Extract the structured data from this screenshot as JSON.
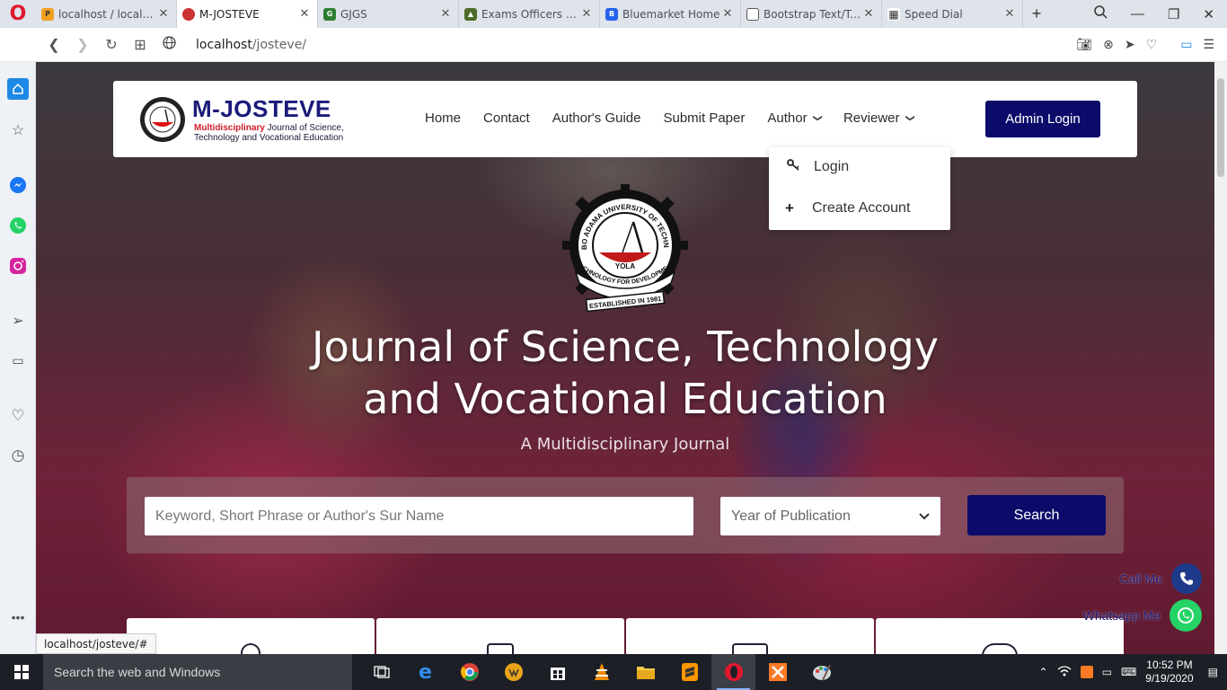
{
  "browser": {
    "tabs": [
      {
        "favicon": "phpmyadmin-favicon",
        "title": "localhost / localhost"
      },
      {
        "favicon": "mau-seal-favicon",
        "title": "M-JOSTEVE",
        "active": true
      },
      {
        "favicon": "leaf-favicon",
        "title": "GJGS"
      },
      {
        "favicon": "hat-favicon",
        "title": "Exams Officers Page"
      },
      {
        "favicon": "bluemarket-favicon",
        "title": "Bluemarket Home"
      },
      {
        "favicon": "document-favicon",
        "title": "Bootstrap Text/Typography"
      },
      {
        "favicon": "grid-favicon",
        "title": "Speed Dial"
      }
    ],
    "url": {
      "host": "localhost",
      "path": "/josteve/"
    },
    "status_url": "localhost/josteve/#"
  },
  "site": {
    "logo": {
      "title": "M-JOSTEVE",
      "sub_red": "Multidisciplinary",
      "sub_rest": " Journal of Science, Technology and Vocational Education"
    },
    "menu": {
      "home": "Home",
      "contact": "Contact",
      "guide": "Author's Guide",
      "submit": "Submit Paper",
      "author": "Author",
      "reviewer": "Reviewer"
    },
    "admin_login": "Admin Login",
    "author_dropdown": {
      "login": "Login",
      "create": "Create Account"
    },
    "seal": {
      "top_text": "MODIBBO ADAMA UNIVERSITY OF TECHNOLOGY",
      "center_text": "YOLA",
      "ribbon1": "TECHNOLOGY FOR DEVELOPMENT",
      "ribbon2": "ESTABLISHED IN 1981"
    },
    "hero": {
      "title_line1": "Journal of Science, Technology",
      "title_line2": "and Vocational Education",
      "subtitle": "A Multidisciplinary Journal"
    },
    "search": {
      "placeholder": "Keyword, Short Phrase or Author's Sur Name",
      "year_label": "Year of Publication",
      "button": "Search"
    },
    "floats": {
      "call": "Call Me",
      "whatsapp": "Whatsapp Me"
    }
  },
  "taskbar": {
    "search_text": "Search the web and Windows",
    "time": "10:52 PM",
    "date": "9/19/2020"
  },
  "colors": {
    "brand_navy": "#0c0b6a",
    "opera_red": "#e0182d",
    "whatsapp_green": "#25d366",
    "call_blue": "#1e3a8a"
  }
}
